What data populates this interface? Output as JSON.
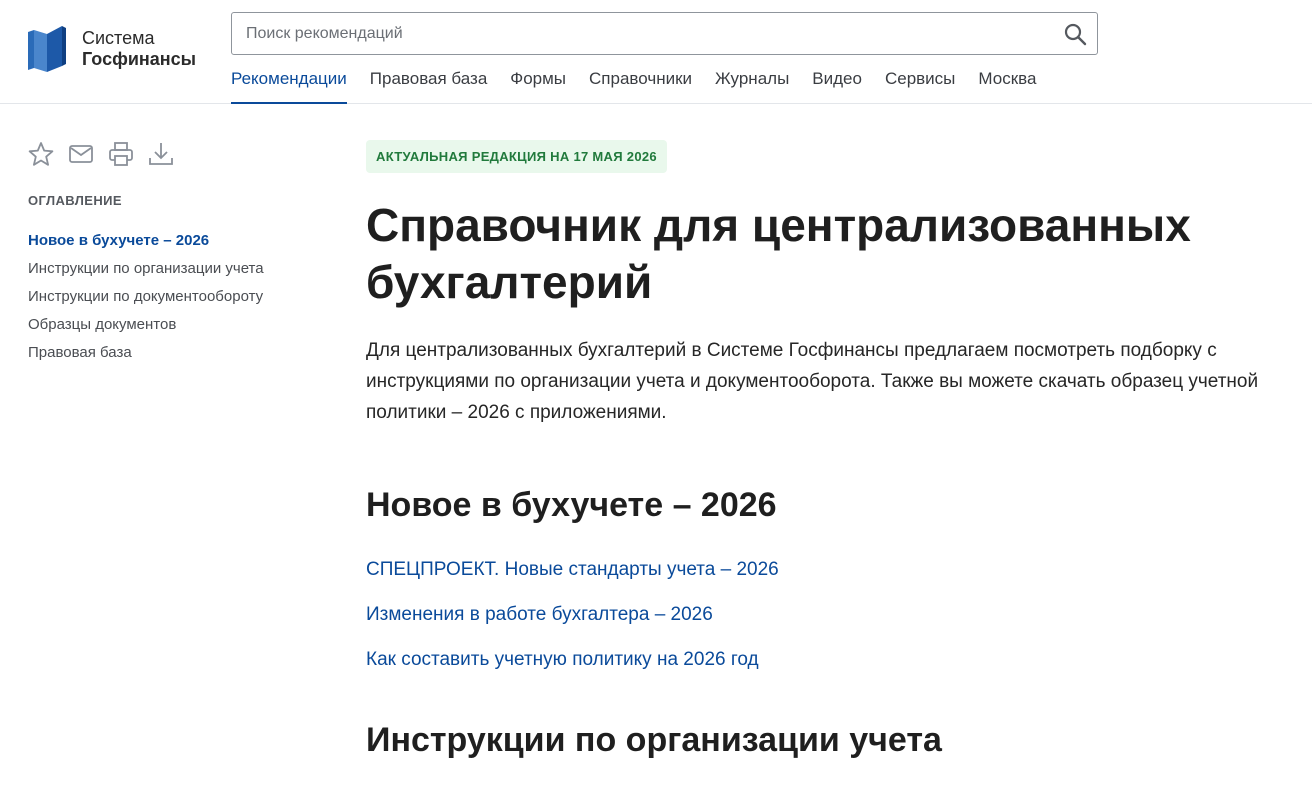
{
  "header": {
    "logo": {
      "line1": "Система",
      "line2": "Госфинансы"
    },
    "search": {
      "placeholder": "Поиск рекомендаций",
      "value": ""
    },
    "nav": [
      {
        "label": "Рекомендации",
        "active": true
      },
      {
        "label": "Правовая база"
      },
      {
        "label": "Формы"
      },
      {
        "label": "Справочники"
      },
      {
        "label": "Журналы"
      },
      {
        "label": "Видео"
      },
      {
        "label": "Сервисы"
      },
      {
        "label": "Москва"
      }
    ],
    "colors": {
      "accent": "#0a4a9a",
      "logo_blue": "#1d59a8"
    }
  },
  "sidebar": {
    "tools": [
      {
        "icon": "star-icon"
      },
      {
        "icon": "mail-icon"
      },
      {
        "icon": "print-icon"
      },
      {
        "icon": "download-icon"
      }
    ],
    "toc_title": "ОГЛАВЛЕНИЕ",
    "toc": [
      {
        "label": "Новое в бухучете – 2026",
        "active": true
      },
      {
        "label": "Инструкции по организации учета"
      },
      {
        "label": "Инструкции по документообороту"
      },
      {
        "label": "Образцы документов"
      },
      {
        "label": "Правовая база"
      }
    ]
  },
  "main": {
    "badge": "АКТУАЛЬНАЯ РЕДАКЦИЯ НА 17 МАЯ 2026",
    "title": "Справочник для централизованных бухгалтерий",
    "intro": "Для централизованных бухгалтерий в Системе Госфинансы предлагаем посмотреть подборку с инструкциями по организации учета и документооборота. Также вы можете скачать образец учетной политики – 2026 с приложениями.",
    "sections": [
      {
        "heading": "Новое в бухучете – 2026",
        "links": [
          "СПЕЦПРОЕКТ. Новые стандарты учета – 2026",
          "Изменения в работе бухгалтера – 2026",
          "Как составить учетную политику на 2026 год"
        ]
      },
      {
        "heading": "Инструкции по организации учета",
        "links": []
      }
    ],
    "colors": {
      "badge_bg": "#e9f8ec",
      "badge_text": "#217a3c",
      "link": "#0a4a9a"
    }
  }
}
